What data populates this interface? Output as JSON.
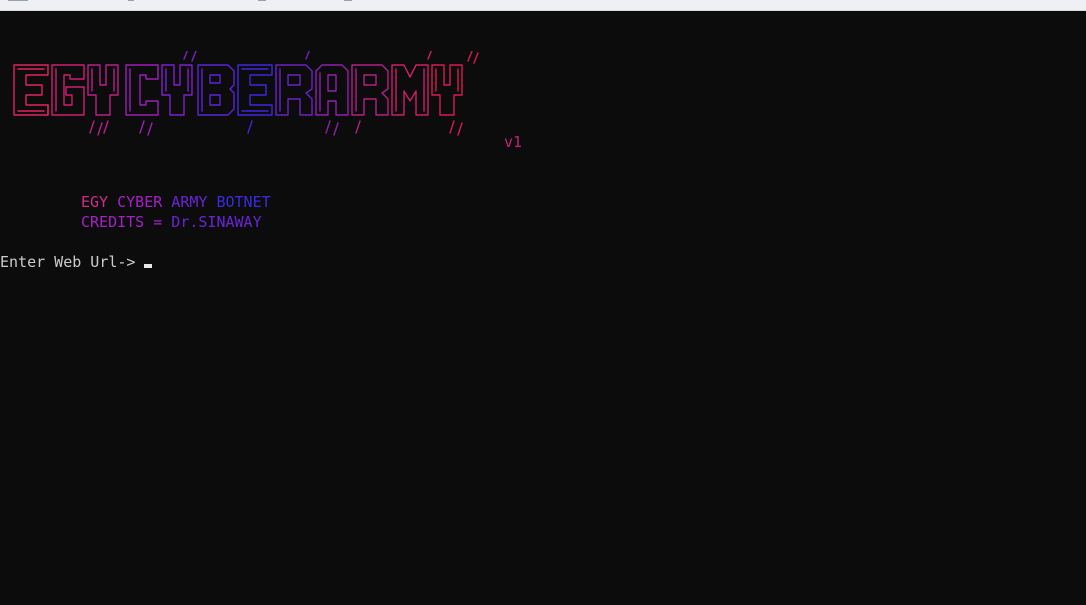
{
  "window": {
    "titlebar_icon": "console-icon"
  },
  "banner": {
    "logo_text": "EGYCYBERARMY",
    "version": "v1",
    "colors": [
      "#e0245e",
      "#c01f8a",
      "#8a1fd0",
      "#3b2bd9",
      "#2f22e6",
      "#d41c55"
    ]
  },
  "info": {
    "line1_parts": [
      "EGY",
      " CYBER",
      " ARMY",
      " BOTNET"
    ],
    "line2_parts": [
      "CREDITS",
      " =",
      " Dr.",
      "SINAWAY"
    ]
  },
  "prompt": {
    "label": "Enter Web Url->"
  }
}
